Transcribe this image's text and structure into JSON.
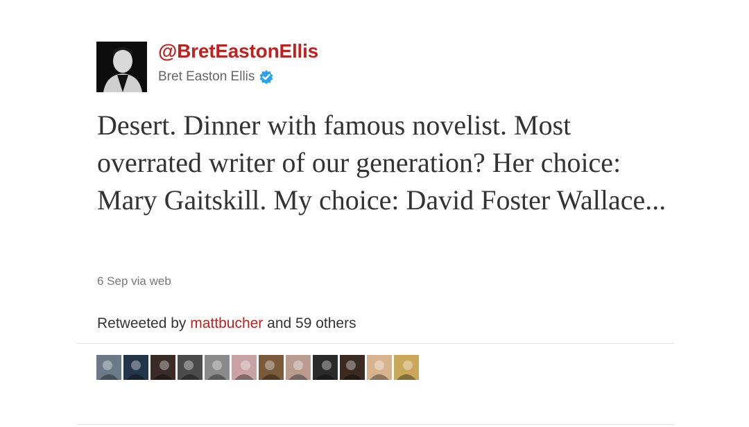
{
  "tweet": {
    "handle": "@BretEastonEllis",
    "display_name": "Bret Easton Ellis",
    "verified_icon": "verified-badge-icon",
    "text": "Desert. Dinner with famous novelist. Most overrated writer of our generation? Her choice: Mary Gaitskill. My choice: David Foster Wallace...",
    "timestamp": "6 Sep via web"
  },
  "retweets": {
    "prefix": "Retweeted by ",
    "user": "mattbucher",
    "suffix": " and 59 others",
    "avatars": [
      {
        "name": "retweeter-avatar-1",
        "bg": "#6b7a86"
      },
      {
        "name": "retweeter-avatar-2",
        "bg": "#22354a"
      },
      {
        "name": "retweeter-avatar-3",
        "bg": "#3a2b26"
      },
      {
        "name": "retweeter-avatar-4",
        "bg": "#4b4b4b"
      },
      {
        "name": "retweeter-avatar-5",
        "bg": "#8a8a8a"
      },
      {
        "name": "retweeter-avatar-6",
        "bg": "#c9a3a3"
      },
      {
        "name": "retweeter-avatar-7",
        "bg": "#7a5a3a"
      },
      {
        "name": "retweeter-avatar-8",
        "bg": "#b99b90"
      },
      {
        "name": "retweeter-avatar-9",
        "bg": "#2a2a2a"
      },
      {
        "name": "retweeter-avatar-10",
        "bg": "#3b2a22"
      },
      {
        "name": "retweeter-avatar-11",
        "bg": "#d7b48f"
      },
      {
        "name": "retweeter-avatar-12",
        "bg": "#c9a85a"
      }
    ]
  },
  "colors": {
    "accent": "#c0201e",
    "verified": "#2aa3ef",
    "text": "#333333",
    "muted": "#777777"
  }
}
